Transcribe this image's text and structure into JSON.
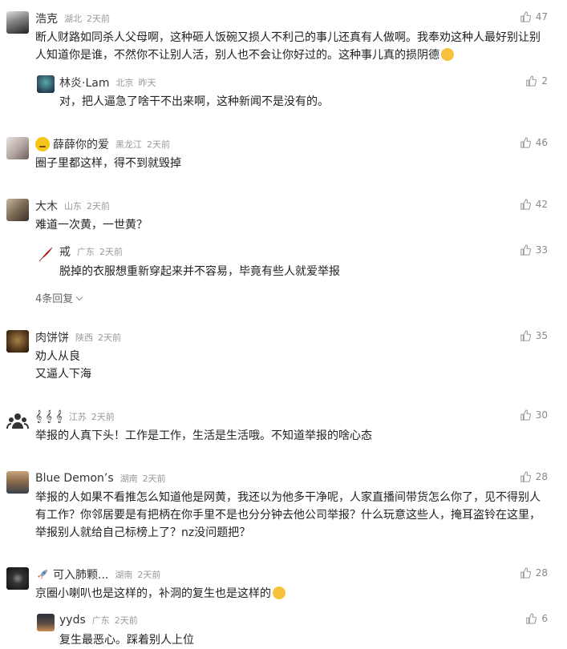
{
  "comments": [
    {
      "user": "浩克",
      "location": "湖北",
      "time": "2天前",
      "likes": "47",
      "text": "断人财路如同杀人父母啊，这种砸人饭碗又损人不利己的事儿还真有人做啊。我奉劝这种人最好别让别人知道你是谁，不然你不让别人活，别人也不会让你好过的。这种事儿真的损阴德",
      "reply": {
        "user": "林炎·Lam",
        "location": "北京",
        "time": "昨天",
        "likes": "2",
        "text": "对，把人逼急了啥干不出来啊，这种新闻不是没有的。"
      }
    },
    {
      "user": "薛薛你的爱",
      "location": "黑龙江",
      "time": "2天前",
      "likes": "46",
      "text": "圈子里都这样，得不到就毁掉"
    },
    {
      "user": "大木",
      "location": "山东",
      "time": "2天前",
      "likes": "42",
      "text": "难道一次黄，一世黄？",
      "reply": {
        "user": "戒",
        "location": "广东",
        "time": "2天前",
        "likes": "33",
        "text": "脱掉的衣服想重新穿起来并不容易，毕竟有些人就爱举报"
      },
      "more": "4条回复"
    },
    {
      "user": "肉饼饼",
      "location": "陕西",
      "time": "2天前",
      "likes": "35",
      "text": "劝人从良",
      "text2": "又逼人下海"
    },
    {
      "user": "𝄞 𝄞 𝄞",
      "location": "江苏",
      "time": "2天前",
      "likes": "30",
      "text": "举报的人真下头！工作是工作，生活是生活哦。不知道举报的啥心态"
    },
    {
      "user": "Blue Demon’s",
      "location": "湖南",
      "time": "2天前",
      "likes": "28",
      "text": "举报的人如果不看推怎么知道他是网黄，我还以为他多干净呢，人家直播间带货怎么你了，见不得别人有工作？你邻居要是有把柄在你手里不是也分分钟去他公司举报？什么玩意这些人，掩耳盗铃在这里，举报别人就给自己标榜上了？nz没问题把？"
    },
    {
      "user": "可入肺颗...",
      "location": "湖南",
      "time": "2天前",
      "likes": "28",
      "text": "京圈小喇叭也是这样的，补洞的复生也是这样的",
      "reply": {
        "user": "yyds",
        "location": "广东",
        "time": "2天前",
        "likes": "6",
        "text": "复生最恶心。踩着别人上位"
      }
    }
  ],
  "colors": {
    "meta": "#999999",
    "text": "#222222",
    "like": "#888888"
  }
}
